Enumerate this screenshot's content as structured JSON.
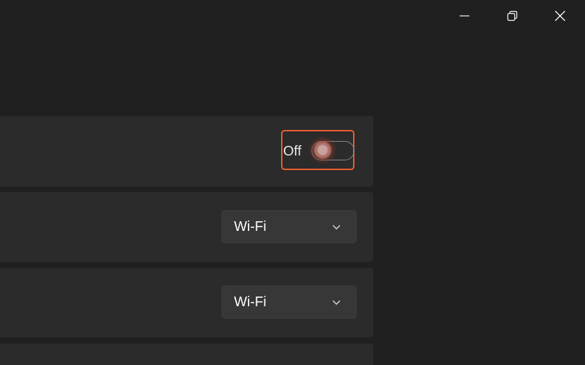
{
  "window": {
    "controls": {
      "minimize_icon": "minimize-icon",
      "maximize_icon": "restore-icon",
      "close_icon": "close-icon"
    }
  },
  "settings": {
    "toggle": {
      "state_label": "Off",
      "is_on": false
    },
    "dropdown_1": {
      "value": "Wi-Fi",
      "chevron_icon": "chevron-down-icon"
    },
    "dropdown_2": {
      "value": "Wi-Fi",
      "chevron_icon": "chevron-down-icon"
    }
  },
  "colors": {
    "background": "#202020",
    "card": "#2b2b2b",
    "focus_ring": "#f06030",
    "dropdown": "#373737"
  }
}
